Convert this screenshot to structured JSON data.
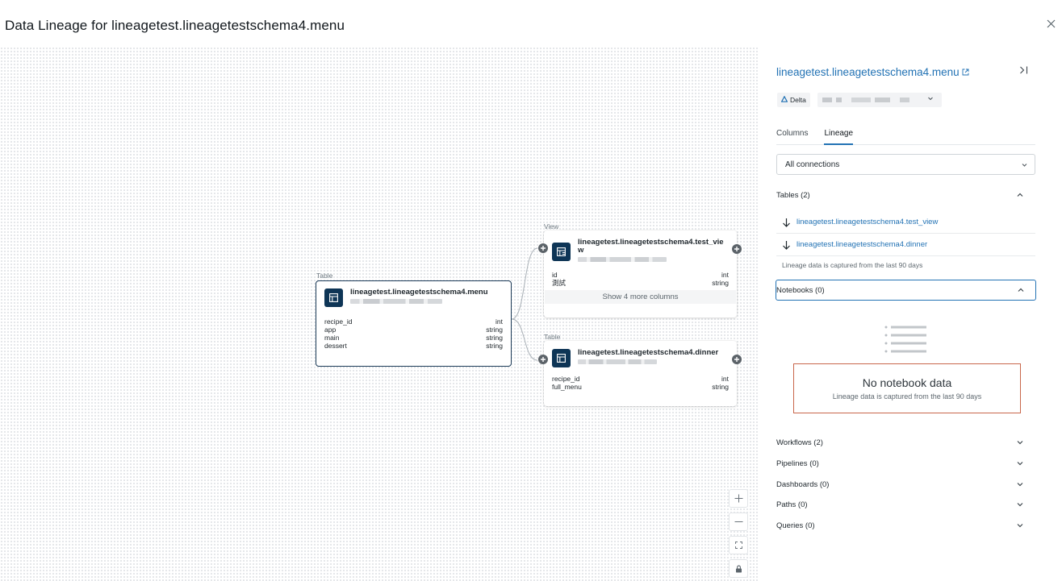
{
  "header": {
    "title": "Data Lineage for lineagetest.lineagetestschema4.menu"
  },
  "graph": {
    "center_node": {
      "type_label": "Table",
      "name": "lineagetest.lineagetestschema4.menu",
      "columns": [
        {
          "name": "recipe_id",
          "type": "int"
        },
        {
          "name": "app",
          "type": "string"
        },
        {
          "name": "main",
          "type": "string"
        },
        {
          "name": "dessert",
          "type": "string"
        }
      ]
    },
    "view_node": {
      "type_label": "View",
      "name": "lineagetest.lineagetestschema4.test_view",
      "columns": [
        {
          "name": "id",
          "type": "int"
        },
        {
          "name": "測試",
          "type": "string"
        }
      ],
      "show_more": "Show 4 more columns"
    },
    "dinner_node": {
      "type_label": "Table",
      "name": "lineagetest.lineagetestschema4.dinner",
      "columns": [
        {
          "name": "recipe_id",
          "type": "int"
        },
        {
          "name": "full_menu",
          "type": "string"
        }
      ]
    },
    "zoom_controls": [
      "zoom-in",
      "zoom-out",
      "fit-view",
      "lock"
    ]
  },
  "panel": {
    "title": "lineagetest.lineagetestschema4.menu",
    "format_badge": "Delta",
    "tabs": [
      {
        "label": "Columns",
        "active": false
      },
      {
        "label": "Lineage",
        "active": true
      }
    ],
    "connections_select": "All connections",
    "tables_section": {
      "label": "Tables (2)",
      "expanded": true,
      "items": [
        "lineagetest.lineagetestschema4.test_view",
        "lineagetest.lineagetestschema4.dinner"
      ],
      "note": "Lineage data is captured from the last 90 days"
    },
    "notebooks_section": {
      "label": "Notebooks (0)",
      "expanded": true,
      "empty_title": "No notebook data",
      "empty_subtitle": "Lineage data is captured from the last 90 days"
    },
    "collapsed_sections": [
      "Workflows (2)",
      "Pipelines (0)",
      "Dashboards (0)",
      "Paths (0)",
      "Queries (0)"
    ]
  },
  "colors": {
    "link": "#2272b4",
    "node_icon_bg": "#0e3556",
    "selected_border": "#1b3a57",
    "empty_state_border": "#c8664b"
  }
}
